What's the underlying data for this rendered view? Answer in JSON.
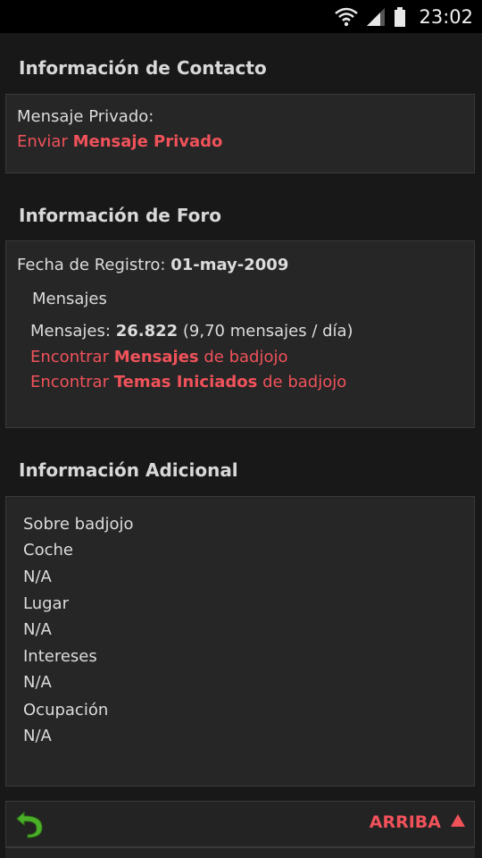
{
  "status_bar": {
    "time": "23:02"
  },
  "contact": {
    "title": "Información de Contacto",
    "pm_label": "Mensaje Privado:",
    "send_prefix": "Enviar",
    "send_bold": "Mensaje Privado"
  },
  "forum": {
    "title": "Información de Foro",
    "reg_label": "Fecha de Registro:",
    "reg_date": "01-may-2009",
    "messages_heading": "Mensajes",
    "messages_label": "Mensajes:",
    "messages_count": "26.822",
    "messages_rate": "(9,70 mensajes / día)",
    "find_prefix": "Encontrar",
    "find_posts_bold": "Mensajes",
    "find_posts_suffix": "de badjojo",
    "find_threads_bold": "Temas Iniciados",
    "find_threads_suffix": "de badjojo"
  },
  "additional": {
    "title": "Información Adicional",
    "about": "Sobre badjojo",
    "fields": [
      {
        "label": "Coche",
        "value": "N/A"
      },
      {
        "label": "Lugar",
        "value": "N/A"
      },
      {
        "label": "Intereses",
        "value": "N/A"
      },
      {
        "label": "Ocupación",
        "value": "N/A"
      }
    ]
  },
  "footer": {
    "top_label": "ARRIBA"
  },
  "colors": {
    "accent": "#f0525a",
    "back_icon": "#4caf2a"
  }
}
